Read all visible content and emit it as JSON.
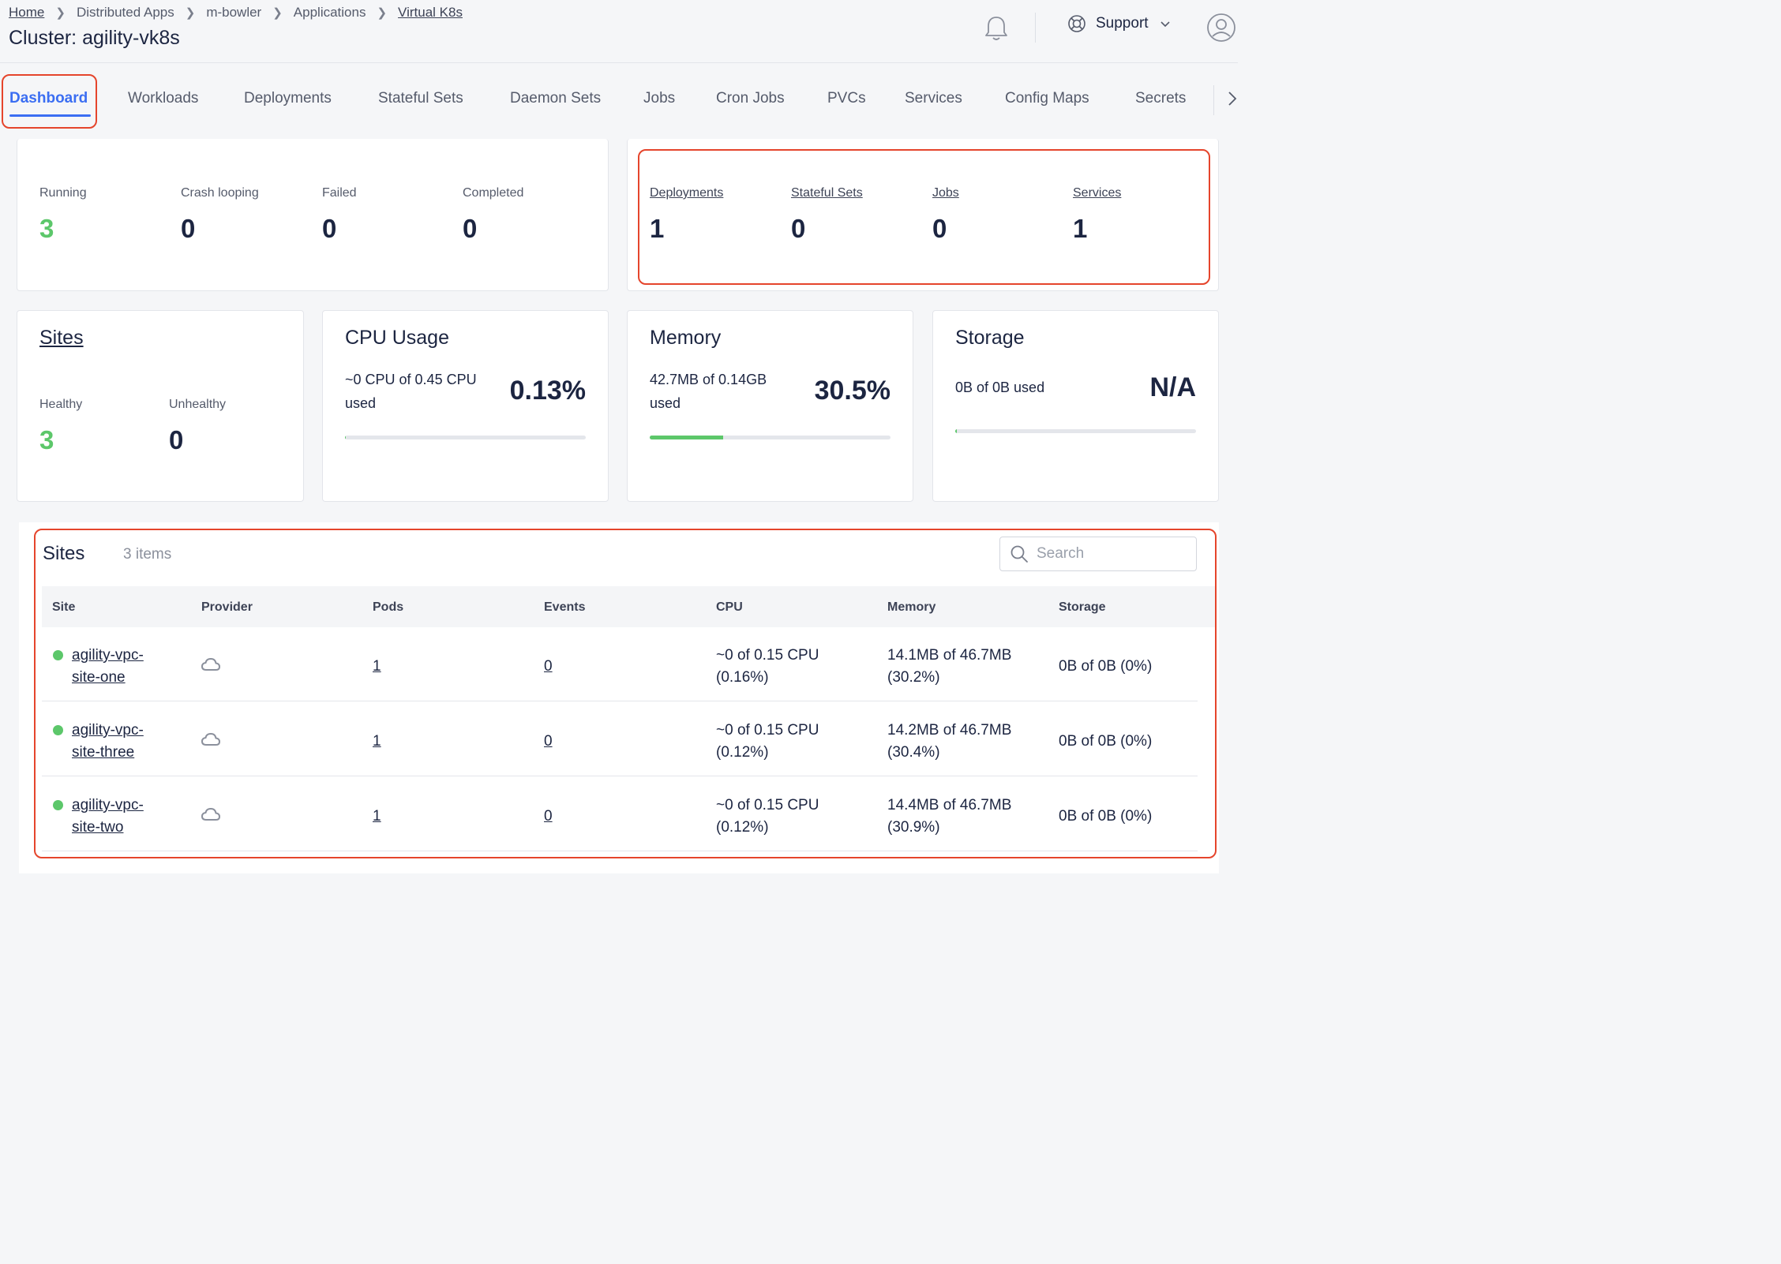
{
  "breadcrumb": [
    "Home",
    "Distributed Apps",
    "m-bowler",
    "Applications",
    "Virtual K8s"
  ],
  "page_title": "Cluster: agility-vk8s",
  "header": {
    "support_label": "Support"
  },
  "tabs": [
    "Dashboard",
    "Workloads",
    "Deployments",
    "Stateful Sets",
    "Daemon Sets",
    "Jobs",
    "Cron Jobs",
    "PVCs",
    "Services",
    "Config Maps",
    "Secrets"
  ],
  "active_tab": "Dashboard",
  "pod_status": [
    {
      "label": "Running",
      "value": "3"
    },
    {
      "label": "Crash looping",
      "value": "0"
    },
    {
      "label": "Failed",
      "value": "0"
    },
    {
      "label": "Completed",
      "value": "0"
    }
  ],
  "resources": [
    {
      "label": "Deployments",
      "value": "1"
    },
    {
      "label": "Stateful Sets",
      "value": "0"
    },
    {
      "label": "Jobs",
      "value": "0"
    },
    {
      "label": "Services",
      "value": "1"
    }
  ],
  "sites_card": {
    "title": "Sites",
    "healthy_label": "Healthy",
    "healthy_value": "3",
    "unhealthy_label": "Unhealthy",
    "unhealthy_value": "0"
  },
  "cpu": {
    "title": "CPU Usage",
    "line1": "~0 CPU of 0.45 CPU",
    "line2": "used",
    "percent": "0.13%",
    "fraction": 0.0013
  },
  "memory": {
    "title": "Memory",
    "line1": "42.7MB of 0.14GB",
    "line2": "used",
    "percent": "30.5%",
    "fraction": 0.305
  },
  "storage": {
    "title": "Storage",
    "text": "0B of 0B used",
    "percent": "N/A",
    "fraction": 0
  },
  "sites_table": {
    "title": "Sites",
    "count": "3 items",
    "search_placeholder": "Search",
    "columns": [
      "Site",
      "Provider",
      "Pods",
      "Events",
      "CPU",
      "Memory",
      "Storage"
    ],
    "rows": [
      {
        "site_line1": "agility-vpc-",
        "site_line2": "site-one",
        "provider_icon": "cloud-icon",
        "pods": "1",
        "events": "0",
        "cpu_line1": "~0 of 0.15 CPU",
        "cpu_line2": "(0.16%)",
        "mem_line1": "14.1MB of 46.7MB",
        "mem_line2": "(30.2%)",
        "storage": "0B of 0B (0%)"
      },
      {
        "site_line1": "agility-vpc-",
        "site_line2": "site-three",
        "provider_icon": "cloud-icon",
        "pods": "1",
        "events": "0",
        "cpu_line1": "~0 of 0.15 CPU",
        "cpu_line2": "(0.12%)",
        "mem_line1": "14.2MB of 46.7MB",
        "mem_line2": "(30.4%)",
        "storage": "0B of 0B (0%)"
      },
      {
        "site_line1": "agility-vpc-",
        "site_line2": "site-two",
        "provider_icon": "cloud-icon",
        "pods": "1",
        "events": "0",
        "cpu_line1": "~0 of 0.15 CPU",
        "cpu_line2": "(0.12%)",
        "mem_line1": "14.4MB of 46.7MB",
        "mem_line2": "(30.9%)",
        "storage": "0B of 0B (0%)"
      }
    ]
  },
  "colors": {
    "accent": "#3b6ef2",
    "healthy": "#5cc76a",
    "highlight": "#e5452c",
    "text": "#1c2541"
  }
}
